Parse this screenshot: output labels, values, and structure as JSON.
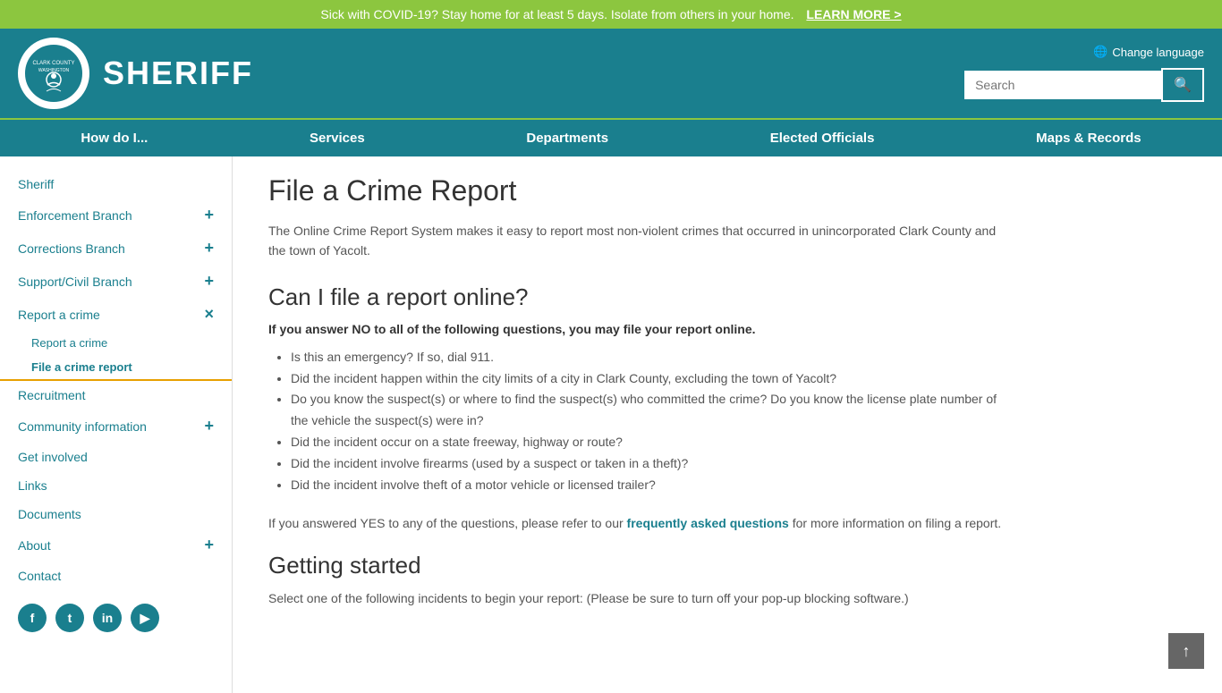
{
  "alert": {
    "message": "Sick with COVID-19? Stay home for at least 5 days. Isolate from others in your home.",
    "link_text": "LEARN MORE >"
  },
  "header": {
    "site_title": "SHERIFF",
    "language_label": "Change language",
    "search_placeholder": "Search"
  },
  "nav": {
    "items": [
      {
        "label": "How do I...",
        "id": "how-do-i"
      },
      {
        "label": "Services",
        "id": "services"
      },
      {
        "label": "Departments",
        "id": "departments"
      },
      {
        "label": "Elected Officials",
        "id": "elected-officials"
      },
      {
        "label": "Maps & Records",
        "id": "maps-records"
      }
    ]
  },
  "sidebar": {
    "items": [
      {
        "label": "Sheriff",
        "type": "plain"
      },
      {
        "label": "Enforcement Branch",
        "type": "expandable",
        "icon": "+"
      },
      {
        "label": "Corrections Branch",
        "type": "expandable",
        "icon": "+"
      },
      {
        "label": "Support/Civil Branch",
        "type": "expandable",
        "icon": "+"
      },
      {
        "label": "Report a crime",
        "type": "expandable-open",
        "icon": "×"
      },
      {
        "label": "Recruitment",
        "type": "plain"
      },
      {
        "label": "Community information",
        "type": "expandable",
        "icon": "+"
      },
      {
        "label": "Get involved",
        "type": "plain"
      },
      {
        "label": "Links",
        "type": "plain"
      },
      {
        "label": "Documents",
        "type": "plain"
      },
      {
        "label": "About",
        "type": "expandable",
        "icon": "+"
      },
      {
        "label": "Contact",
        "type": "plain"
      }
    ],
    "subitems": [
      {
        "label": "Report a crime",
        "active": false
      },
      {
        "label": "File a crime report",
        "active": true
      }
    ]
  },
  "social": {
    "items": [
      {
        "label": "f",
        "name": "facebook"
      },
      {
        "label": "t",
        "name": "twitter"
      },
      {
        "label": "in",
        "name": "instagram"
      },
      {
        "label": "▶",
        "name": "youtube"
      }
    ]
  },
  "main": {
    "page_title": "File a Crime Report",
    "intro": "The Online Crime Report System makes it easy to report most non-violent crimes that occurred in unincorporated Clark County and the town of Yacolt.",
    "section1_heading": "Can I file a report online?",
    "section1_bold": "If you answer NO to all of the following questions, you may file your report online.",
    "bullets": [
      "Is this an emergency? If so, dial 911.",
      "Did the incident happen within the city limits of a city in Clark County, excluding the town of Yacolt?",
      "Do you know the suspect(s) or where to find the suspect(s) who committed the crime? Do you know the license plate number of the vehicle the suspect(s) were in?",
      "Did the incident occur on a state freeway, highway or route?",
      "Did the incident involve firearms (used by a suspect or taken in a theft)?",
      "Did the incident involve theft of a motor vehicle or licensed trailer?"
    ],
    "faq_before": "If you answered YES to any of the questions, please refer to our ",
    "faq_link_text": "frequently asked questions",
    "faq_after": " for more information on filing a report.",
    "section2_heading": "Getting started",
    "section2_text": "Select one of the following incidents to begin your report: (Please be sure to turn off your pop-up blocking software.)"
  }
}
